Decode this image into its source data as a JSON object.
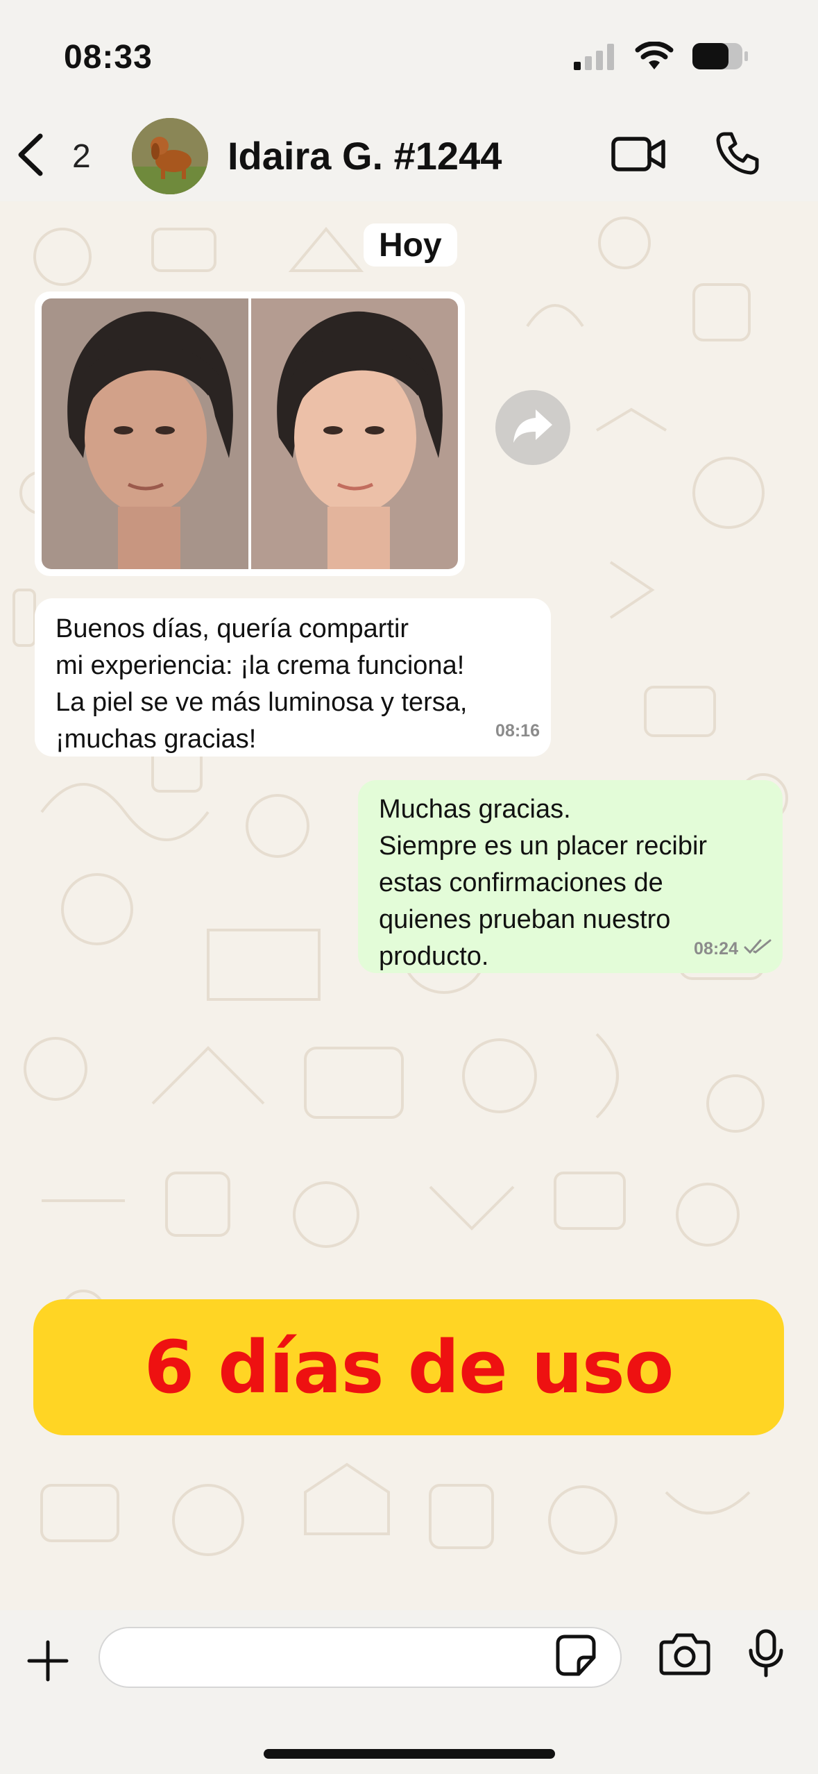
{
  "status_bar": {
    "time": "08:33",
    "icons": [
      "cellular-signal-icon",
      "wifi-icon",
      "battery-icon"
    ]
  },
  "header": {
    "back_count": "2",
    "contact_name": "Idaira G. #1244",
    "icons": [
      "chevron-left-icon",
      "video-camera-icon",
      "phone-icon"
    ]
  },
  "chat": {
    "day_label": "Hoy",
    "messages": [
      {
        "direction": "incoming",
        "type": "image",
        "description_icon": "before-after-photo"
      },
      {
        "direction": "incoming",
        "type": "text",
        "lines": [
          "Buenos días, quería compartir",
          "mi experiencia: ¡la crema funciona!",
          "La piel se ve más luminosa y tersa,",
          "¡muchas gracias!"
        ],
        "time": "08:16"
      },
      {
        "direction": "outgoing",
        "type": "text",
        "lines": [
          "Muchas gracias.",
          "Siempre es un placer recibir",
          "estas confirmaciones de",
          "quienes prueban nuestro",
          "producto."
        ],
        "time": "08:24",
        "status": "read"
      }
    ]
  },
  "banner": {
    "text": "6 días de uso",
    "background_color": "#ffd524",
    "text_color": "#ee1111"
  },
  "input_bar": {
    "placeholder": "",
    "icons": [
      "plus-icon",
      "sticker-icon",
      "camera-icon",
      "microphone-icon"
    ]
  },
  "colors": {
    "incoming_bubble": "#ffffff",
    "outgoing_bubble": "#e3fcd8",
    "chat_background": "#f5f1ea"
  }
}
